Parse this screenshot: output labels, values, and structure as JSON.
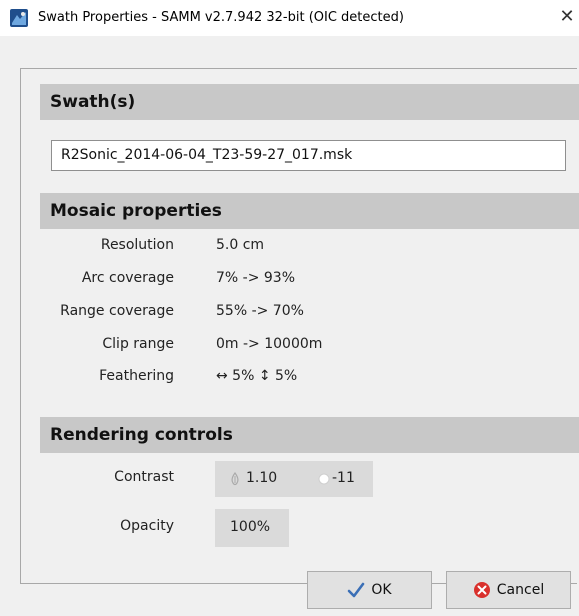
{
  "window": {
    "title": "Swath Properties - SAMM v2.7.942 32-bit (OIC detected)"
  },
  "swaths": {
    "header": "Swath(s)",
    "file": "R2Sonic_2014-06-04_T23-59-27_017.msk"
  },
  "mosaic": {
    "header": "Mosaic properties",
    "rows": [
      {
        "label": "Resolution",
        "value": "5.0 cm"
      },
      {
        "label": "Arc coverage",
        "value": "7% -> 93%"
      },
      {
        "label": "Range coverage",
        "value": "55% -> 70%"
      },
      {
        "label": "Clip range",
        "value": "0m -> 10000m"
      },
      {
        "label": "Feathering",
        "value": "↔ 5% ↕ 5%"
      }
    ]
  },
  "rendering": {
    "header": "Rendering controls",
    "contrast_label": "Contrast",
    "contrast_value": "1.10",
    "brightness_value": "-11",
    "opacity_label": "Opacity",
    "opacity_value": "100%"
  },
  "buttons": {
    "ok": "OK",
    "cancel": "Cancel"
  },
  "colors": {
    "header_bg": "#c8c8c8",
    "ok_check": "#3b6fb6",
    "cancel_red": "#d9302c"
  }
}
